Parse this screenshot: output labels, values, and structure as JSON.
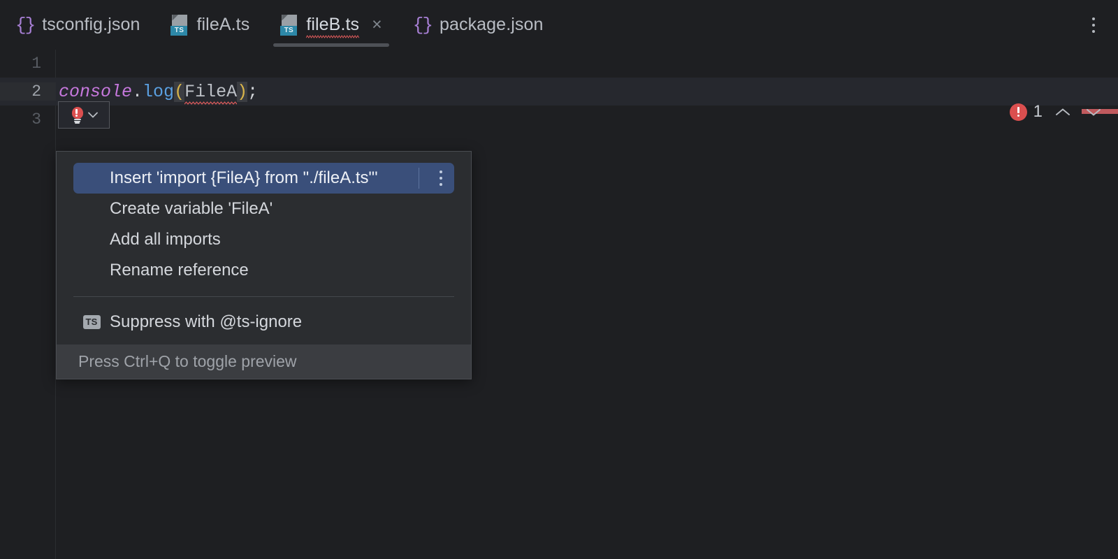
{
  "window": {
    "background": "#1e1f22",
    "accent": "#3a4f7a",
    "error_color": "#db4f4f"
  },
  "tabs": {
    "items": [
      {
        "label": "tsconfig.json",
        "icon": "json-braces-icon",
        "active": false,
        "closable": false,
        "has_error": false
      },
      {
        "label": "fileA.ts",
        "icon": "typescript-file-icon",
        "active": false,
        "closable": false,
        "has_error": false
      },
      {
        "label": "fileB.ts",
        "icon": "typescript-file-icon",
        "active": true,
        "closable": true,
        "has_error": true
      },
      {
        "label": "package.json",
        "icon": "json-braces-icon",
        "active": false,
        "closable": false,
        "has_error": false
      }
    ],
    "close_glyph": "×",
    "overflow_menu": "more-options-icon"
  },
  "editor": {
    "lines": [
      {
        "number": "1",
        "caret": false
      },
      {
        "number": "2",
        "caret": true
      },
      {
        "number": "3",
        "caret": false
      }
    ],
    "code_line_2": {
      "object": "console",
      "dot": ".",
      "method": "log",
      "paren_open": "(",
      "identifier": "FileA",
      "paren_close": ")",
      "semicolon": ";"
    },
    "quick_fix": {
      "icon": "error-lightbulb-icon",
      "dropdown": "chevron-down-icon"
    },
    "inspections": {
      "error_icon": "error-badge-icon",
      "error_count": "1",
      "prev_label": "previous-problem-icon",
      "next_label": "next-problem-icon"
    }
  },
  "popup": {
    "items": [
      {
        "label": "Insert 'import {FileA} from \"./fileA.ts\"'",
        "selected": true,
        "has_submenu": true,
        "icon": null
      },
      {
        "label": "Create variable 'FileA'",
        "selected": false,
        "has_submenu": false,
        "icon": null
      },
      {
        "label": "Add all imports",
        "selected": false,
        "has_submenu": false,
        "icon": null
      },
      {
        "label": "Rename reference",
        "selected": false,
        "has_submenu": false,
        "icon": null
      }
    ],
    "suppress_item": {
      "label": "Suppress with @ts-ignore",
      "icon": "typescript-chip-icon",
      "icon_text": "TS"
    },
    "footer": "Press Ctrl+Q to toggle preview"
  }
}
